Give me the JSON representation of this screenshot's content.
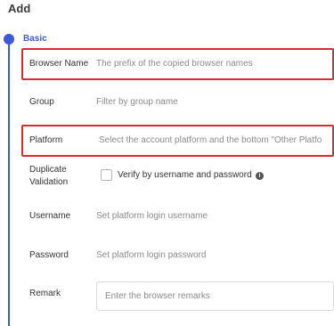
{
  "page": {
    "title": "Add"
  },
  "section": {
    "label": "Basic"
  },
  "fields": {
    "browser_name": {
      "label": "Browser Name",
      "placeholder": "The prefix of the copied browser names"
    },
    "group": {
      "label": "Group",
      "placeholder": "Filter by group name"
    },
    "platform": {
      "label": "Platform",
      "placeholder": "Select the account platform and the bottom \"Other Platfo"
    },
    "duplicate_validation": {
      "label_line1": "Duplicate",
      "label_line2": "Validation",
      "checkbox_label": "Verify by username and password",
      "info_icon": "info-icon"
    },
    "username": {
      "label": "Username",
      "placeholder": "Set platform login username"
    },
    "password": {
      "label": "Password",
      "placeholder": "Set platform login password"
    },
    "remark": {
      "label": "Remark",
      "placeholder": "Enter the browser remarks"
    }
  },
  "colors": {
    "accent": "#3b5bdb",
    "highlight": "#d92d2d"
  }
}
